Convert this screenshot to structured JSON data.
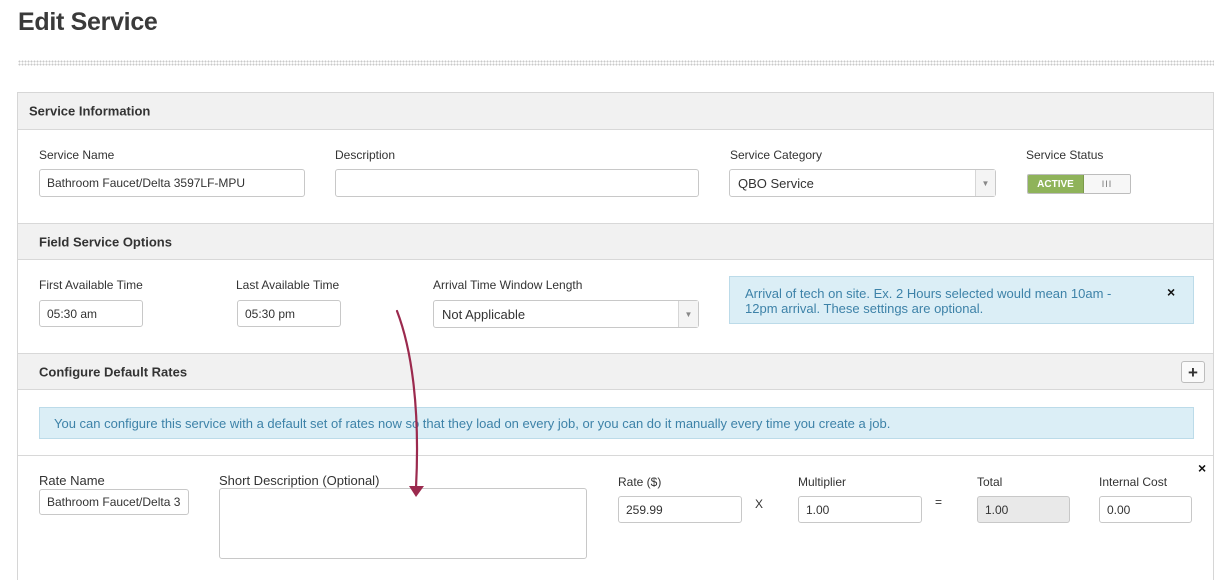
{
  "page": {
    "title": "Edit Service"
  },
  "service_information": {
    "header": "Service Information",
    "service_name": {
      "label": "Service Name",
      "value": "Bathroom Faucet/Delta 3597LF-MPU"
    },
    "description": {
      "label": "Description",
      "value": ""
    },
    "service_category": {
      "label": "Service Category",
      "value": "QBO Service"
    },
    "service_status": {
      "label": "Service Status",
      "on_label": "ACTIVE",
      "off_label": "III",
      "active": true,
      "active_color": "#8fb35a"
    }
  },
  "field_service_options": {
    "header": "Field Service Options",
    "first_available_time": {
      "label": "First Available Time",
      "value": "05:30 am"
    },
    "last_available_time": {
      "label": "Last Available Time",
      "value": "05:30 pm"
    },
    "arrival_window": {
      "label": "Arrival Time Window Length",
      "value": "Not Applicable"
    },
    "info_alert": {
      "line1": "Arrival of tech on site. Ex. 2 Hours selected would mean 10am -",
      "line2": "12pm arrival. These settings are optional.",
      "close": "×"
    }
  },
  "default_rates": {
    "header": "Configure Default Rates",
    "add_button": "+",
    "info_text": "You can configure this service with a default set of rates now so that they load on every job, or you can do it manually every time you create a job.",
    "rate_row": {
      "rate_name": {
        "label": "Rate Name",
        "value": "Bathroom Faucet/Delta 3"
      },
      "short_description": {
        "label": "Short Description (Optional)",
        "value": ""
      },
      "rate": {
        "label": "Rate ($)",
        "value": "259.99"
      },
      "times_symbol": "X",
      "multiplier": {
        "label": "Multiplier",
        "value": "1.00"
      },
      "equals_symbol": "=",
      "total": {
        "label": "Total",
        "value": "1.00"
      },
      "internal_cost": {
        "label": "Internal Cost",
        "value": "0.00"
      },
      "remove": "×"
    }
  },
  "annotation": {
    "arrow_color": "#9b2a4e"
  }
}
